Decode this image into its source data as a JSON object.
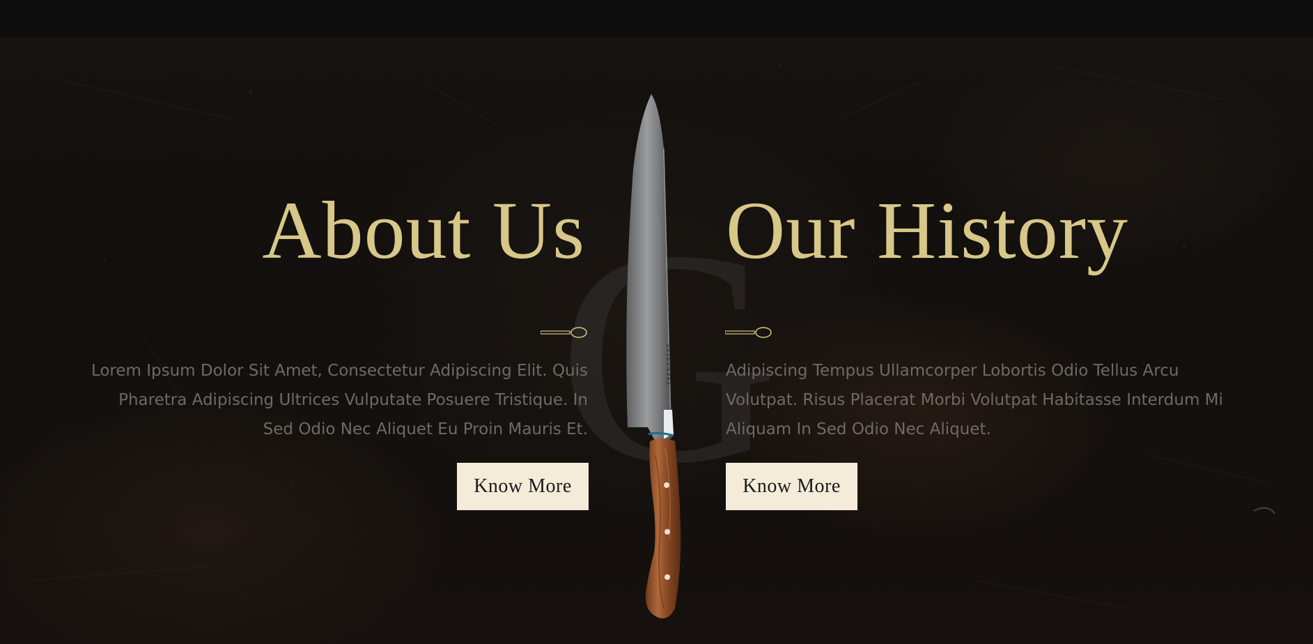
{
  "background_letter": "G",
  "about": {
    "title": "About Us",
    "body": "Lorem Ipsum Dolor Sit Amet, Consectetur Adipiscing Elit. Quis Pharetra Adipiscing Ultrices Vulputate Posuere Tristique. In Sed Odio Nec Aliquet Eu Proin Mauris Et.",
    "button_label": "Know More"
  },
  "history": {
    "title": "Our History",
    "body": "Adipiscing Tempus Ullamcorper Lobortis Odio Tellus Arcu Volutpat. Risus Placerat Morbi Volutpat Habitasse Interdum Mi Aliquam In Sed Odio Nec Aliquet.",
    "button_label": "Know More"
  },
  "knife": {
    "brand_text": "SAVERNAKE"
  },
  "colors": {
    "accent_gold": "#d7c788",
    "button_bg": "#f4ecd9",
    "body_text": "#6e6a66",
    "background": "#120f0d"
  }
}
